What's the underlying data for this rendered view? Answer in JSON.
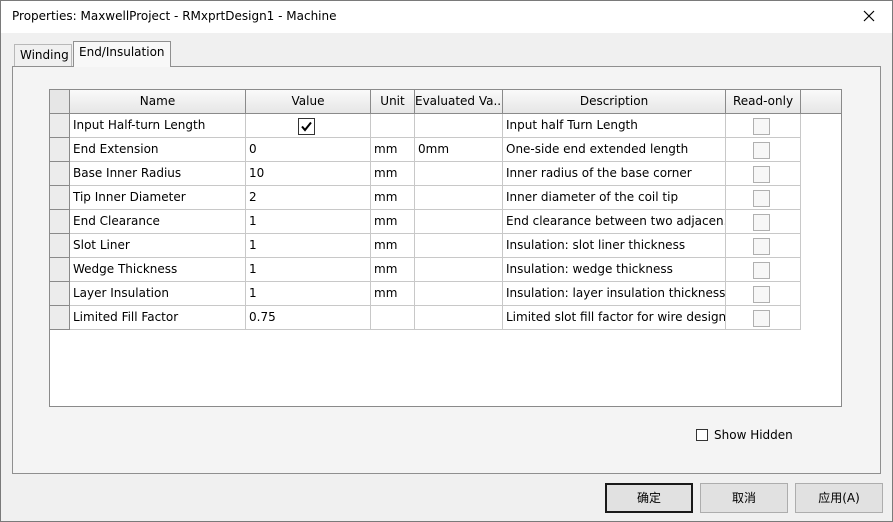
{
  "window": {
    "title": "Properties: MaxwellProject - RMxprtDesign1 - Machine"
  },
  "tabs": [
    {
      "label": "Winding",
      "active": false
    },
    {
      "label": "End/Insulation",
      "active": true
    }
  ],
  "grid": {
    "columns": [
      "Name",
      "Value",
      "Unit",
      "Evaluated Va...",
      "Description",
      "Read-only"
    ],
    "rows": [
      {
        "name": "Input Half-turn Length",
        "value": "",
        "unit": "",
        "evaluated": "",
        "description": "Input half Turn Length",
        "value_checkbox": true
      },
      {
        "name": "End Extension",
        "value": "0",
        "unit": "mm",
        "evaluated": "0mm",
        "description": "One-side end extended length"
      },
      {
        "name": "Base Inner Radius",
        "value": "10",
        "unit": "mm",
        "evaluated": "",
        "description": "Inner radius of the base corner"
      },
      {
        "name": "Tip Inner Diameter",
        "value": "2",
        "unit": "mm",
        "evaluated": "",
        "description": "Inner diameter of the coil tip"
      },
      {
        "name": "End Clearance",
        "value": "1",
        "unit": "mm",
        "evaluated": "",
        "description": "End clearance between two adjacen..."
      },
      {
        "name": "Slot Liner",
        "value": "1",
        "unit": "mm",
        "evaluated": "",
        "description": "Insulation: slot liner thickness"
      },
      {
        "name": "Wedge Thickness",
        "value": "1",
        "unit": "mm",
        "evaluated": "",
        "description": "Insulation: wedge thickness"
      },
      {
        "name": "Layer Insulation",
        "value": "1",
        "unit": "mm",
        "evaluated": "",
        "description": "Insulation: layer insulation thickness"
      },
      {
        "name": "Limited Fill Factor",
        "value": "0.75",
        "unit": "",
        "evaluated": "",
        "description": "Limited slot fill factor for wire design"
      }
    ]
  },
  "show_hidden": {
    "label": "Show Hidden",
    "checked": false
  },
  "buttons": {
    "ok": "确定",
    "cancel": "取消",
    "apply": "应用(A)"
  },
  "colors": {
    "window_bg": "#f0f0f0",
    "grid_bg": "#ffffff",
    "border": "#8a8a8a"
  }
}
